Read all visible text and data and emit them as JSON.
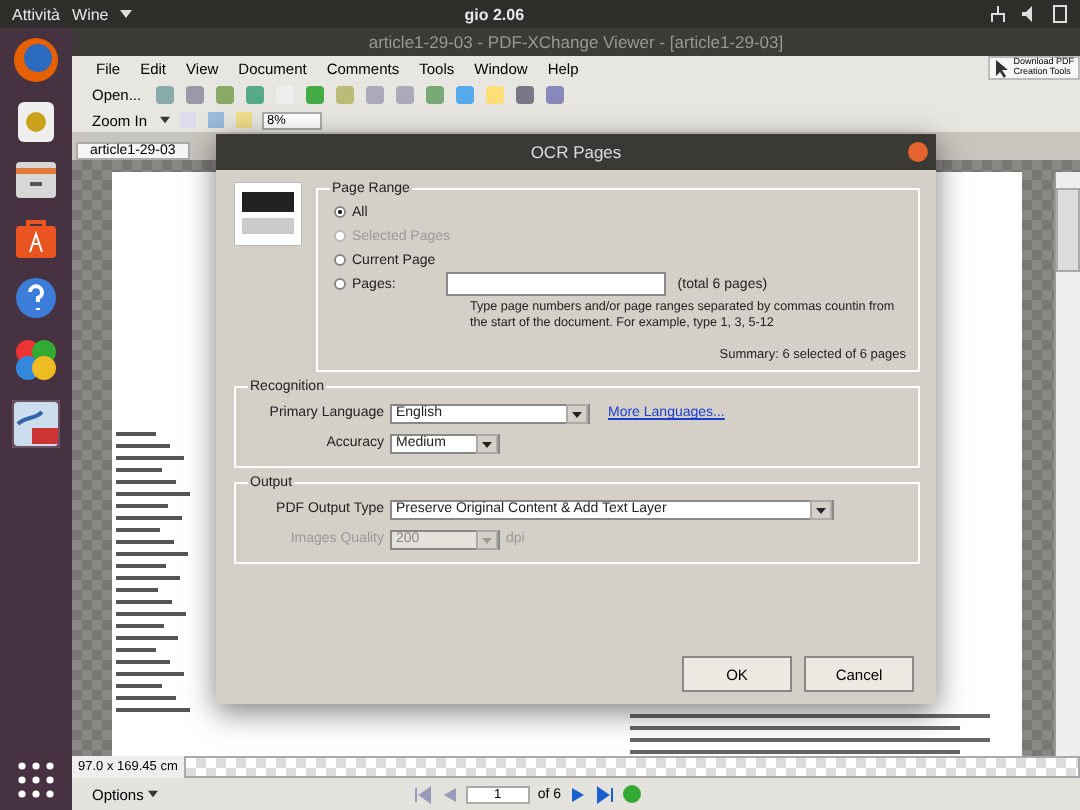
{
  "top_bar": {
    "activities": "Attività",
    "app_menu": "Wine",
    "clock": "gio  2.06"
  },
  "window": {
    "title": "article1-29-03 - PDF-XChange Viewer - [article1-29-03]"
  },
  "menu": [
    "File",
    "Edit",
    "View",
    "Document",
    "Comments",
    "Tools",
    "Window",
    "Help"
  ],
  "promo": {
    "line_1": "Download PDF",
    "line_2": "Creation Tools"
  },
  "toolbar": {
    "open": "Open...",
    "zoom": "Zoom In",
    "zoom_value": "8%"
  },
  "tabs": [
    {
      "label": "article1-29-03",
      "selected": true
    }
  ],
  "status_bar": {
    "size": "97.0 x 169.45 cm",
    "options": "Options",
    "page": "1",
    "of": "of 6"
  },
  "dialog": {
    "title": "OCR Pages",
    "page_range": {
      "title": "Page Range",
      "options": [
        {
          "label": "All",
          "selected": true,
          "disabled": false
        },
        {
          "label": "Selected Pages",
          "selected": false,
          "disabled": true
        },
        {
          "label": "Current Page",
          "selected": false,
          "disabled": false
        },
        {
          "label": "Pages:",
          "selected": false,
          "disabled": false
        }
      ],
      "total": "(total 6 pages)",
      "hint": "Type page numbers and/or page ranges separated by commas countin from the start of the document. For example, type 1, 3, 5-12",
      "summary": "Summary: 6 selected of 6 pages"
    },
    "recognition": {
      "title": "Recognition",
      "language_label": "Primary Language",
      "language": "English",
      "more": "More Languages...",
      "accuracy_label": "Accuracy",
      "accuracy": "Medium"
    },
    "output": {
      "title": "Output",
      "type_label": "PDF Output Type",
      "type": "Preserve Original Content & Add Text Layer",
      "quality_label": "Images Quality",
      "quality": "200",
      "quality_unit": "dpi",
      "quality_disabled": true
    },
    "buttons": [
      "OK",
      "Cancel"
    ]
  }
}
